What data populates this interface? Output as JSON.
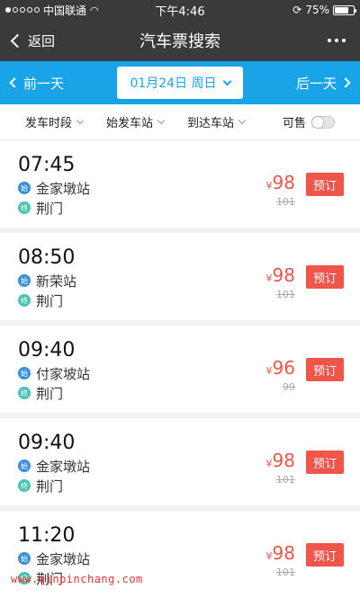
{
  "status": {
    "carrier": "中国联通",
    "time": "下午4:46",
    "battery": "75%",
    "battery_level": 0.75
  },
  "nav": {
    "back_label": "返回",
    "title": "汽车票搜索"
  },
  "date_bar": {
    "prev_label": "前一天",
    "date_label": "01月24日 周日",
    "next_label": "后一天"
  },
  "filters": {
    "time": "发车时段",
    "from": "始发车站",
    "to": "到达车站",
    "available": "可售"
  },
  "badges": {
    "start": "始",
    "end": "终"
  },
  "trips": [
    {
      "time": "07:45",
      "from": "金家墩站",
      "to": "荆门",
      "price": "98",
      "original": "101",
      "book": "预订"
    },
    {
      "time": "08:50",
      "from": "新荣站",
      "to": "荆门",
      "price": "98",
      "original": "101",
      "book": "预订"
    },
    {
      "time": "09:40",
      "from": "付家坡站",
      "to": "荆门",
      "price": "96",
      "original": "99",
      "book": "预订"
    },
    {
      "time": "09:40",
      "from": "金家墩站",
      "to": "荆门",
      "price": "98",
      "original": "101",
      "book": "预订"
    },
    {
      "time": "11:20",
      "from": "金家墩站",
      "to": "荆门",
      "price": "98",
      "original": "101",
      "book": "预订"
    }
  ],
  "currency": "¥",
  "watermark": "www.qinpinchang.com",
  "colors": {
    "accent": "#1aa4e8",
    "price": "#f0554b",
    "nav": "#3a3a3a"
  }
}
